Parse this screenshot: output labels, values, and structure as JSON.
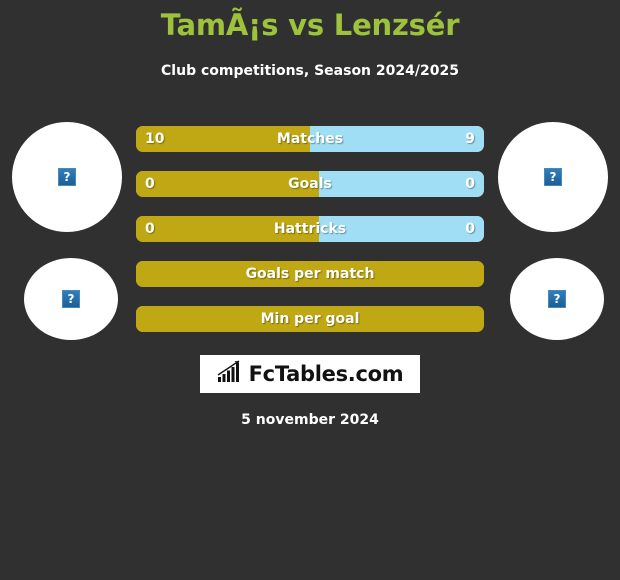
{
  "header": {
    "title": "TamÃ¡s vs Lenzsér",
    "subtitle": "Club competitions, Season 2024/2025",
    "title_color": "#9dc33c"
  },
  "photos": {
    "placeholder_glyph": "?",
    "home_top_alt": "home-player-photo",
    "home_bottom_alt": "home-player-photo",
    "away_top_alt": "away-player-photo",
    "away_bottom_alt": "away-player-photo"
  },
  "colors": {
    "background": "#303030",
    "home_bar": "#bfa813",
    "away_bar": "#9fdef4",
    "text": "#ffffff"
  },
  "chart_data": {
    "type": "bar",
    "title": "TamÃ¡s vs Lenzsér",
    "subtitle": "Club competitions, Season 2024/2025",
    "orientation": "horizontal-diverging",
    "categories": [
      "Matches",
      "Goals",
      "Hattricks",
      "Goals per match",
      "Min per goal"
    ],
    "series": [
      {
        "name": "TamÃ¡s",
        "color": "#bfa813",
        "values": [
          "10",
          "0",
          "0",
          "",
          ""
        ]
      },
      {
        "name": "Lenzsér",
        "color": "#9fdef4",
        "values": [
          "9",
          "0",
          "0",
          "",
          ""
        ]
      }
    ],
    "rows": [
      {
        "label": "Matches",
        "left_value": "10",
        "right_value": "9",
        "left_pct": 50.0,
        "right_pct": 50.0
      },
      {
        "label": "Goals",
        "left_value": "0",
        "right_value": "0",
        "left_pct": 52.5,
        "right_pct": 47.5
      },
      {
        "label": "Hattricks",
        "left_value": "0",
        "right_value": "0",
        "left_pct": 52.5,
        "right_pct": 47.5
      },
      {
        "label": "Goals per match",
        "left_value": "",
        "right_value": "",
        "left_pct": 100,
        "right_pct": 0
      },
      {
        "label": "Min per goal",
        "left_value": "",
        "right_value": "",
        "left_pct": 100,
        "right_pct": 0
      }
    ]
  },
  "logo": {
    "text": "FcTables.com",
    "icon": "bar-chart-growth-icon"
  },
  "footer": {
    "date": "5 november 2024"
  }
}
